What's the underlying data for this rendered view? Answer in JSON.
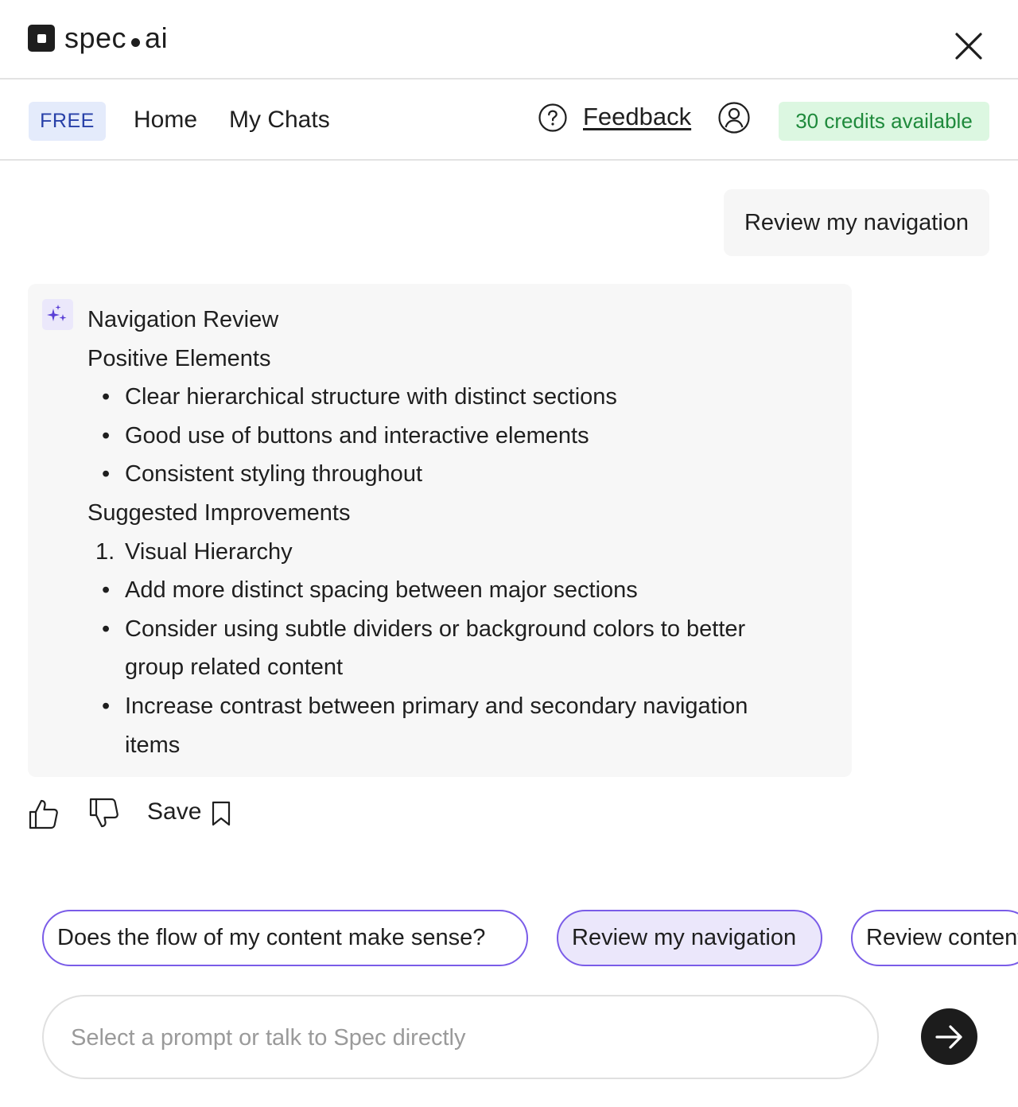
{
  "app": {
    "logo_left": "spec",
    "logo_right": "ai"
  },
  "nav": {
    "plan_badge": "FREE",
    "home": "Home",
    "my_chats": "My Chats",
    "feedback": "Feedback",
    "credits": "30 credits available"
  },
  "chat": {
    "user_message": "Review my navigation",
    "ai_response": {
      "title": "Navigation Review",
      "positive_heading": "Positive Elements",
      "positive_items": [
        "Clear hierarchical structure with distinct sections",
        "Good use of buttons and interactive elements",
        "Consistent styling throughout"
      ],
      "improvements_heading": "Suggested Improvements",
      "numbered_items": [
        {
          "label": "1.",
          "text": "Visual Hierarchy",
          "sub_items": [
            [
              "Add more distinct spacing between major sections"
            ],
            [
              "Consider using subtle dividers or background colors to better",
              "group related content"
            ],
            [
              "Increase contrast between primary and secondary navigation",
              "items"
            ]
          ]
        }
      ]
    },
    "actions": {
      "save": "Save"
    }
  },
  "suggestions": [
    "Does the flow of my content make sense?",
    "Review my navigation",
    "Review content"
  ],
  "composer": {
    "placeholder": "Select a prompt or talk to Spec directly"
  },
  "colors": {
    "accent_purple": "#7a5ce8",
    "free_badge_bg": "#e4ebfb",
    "free_badge_text": "#2740a8",
    "credits_bg": "#dcf7e1",
    "credits_text": "#1f8a3c"
  },
  "icons": {
    "close": "close-icon",
    "help": "help-circle-icon",
    "user": "user-circle-icon",
    "sparkle": "sparkle-icon",
    "thumbs_up": "thumbs-up-icon",
    "thumbs_down": "thumbs-down-icon",
    "bookmark": "bookmark-icon",
    "send": "arrow-right-icon"
  }
}
